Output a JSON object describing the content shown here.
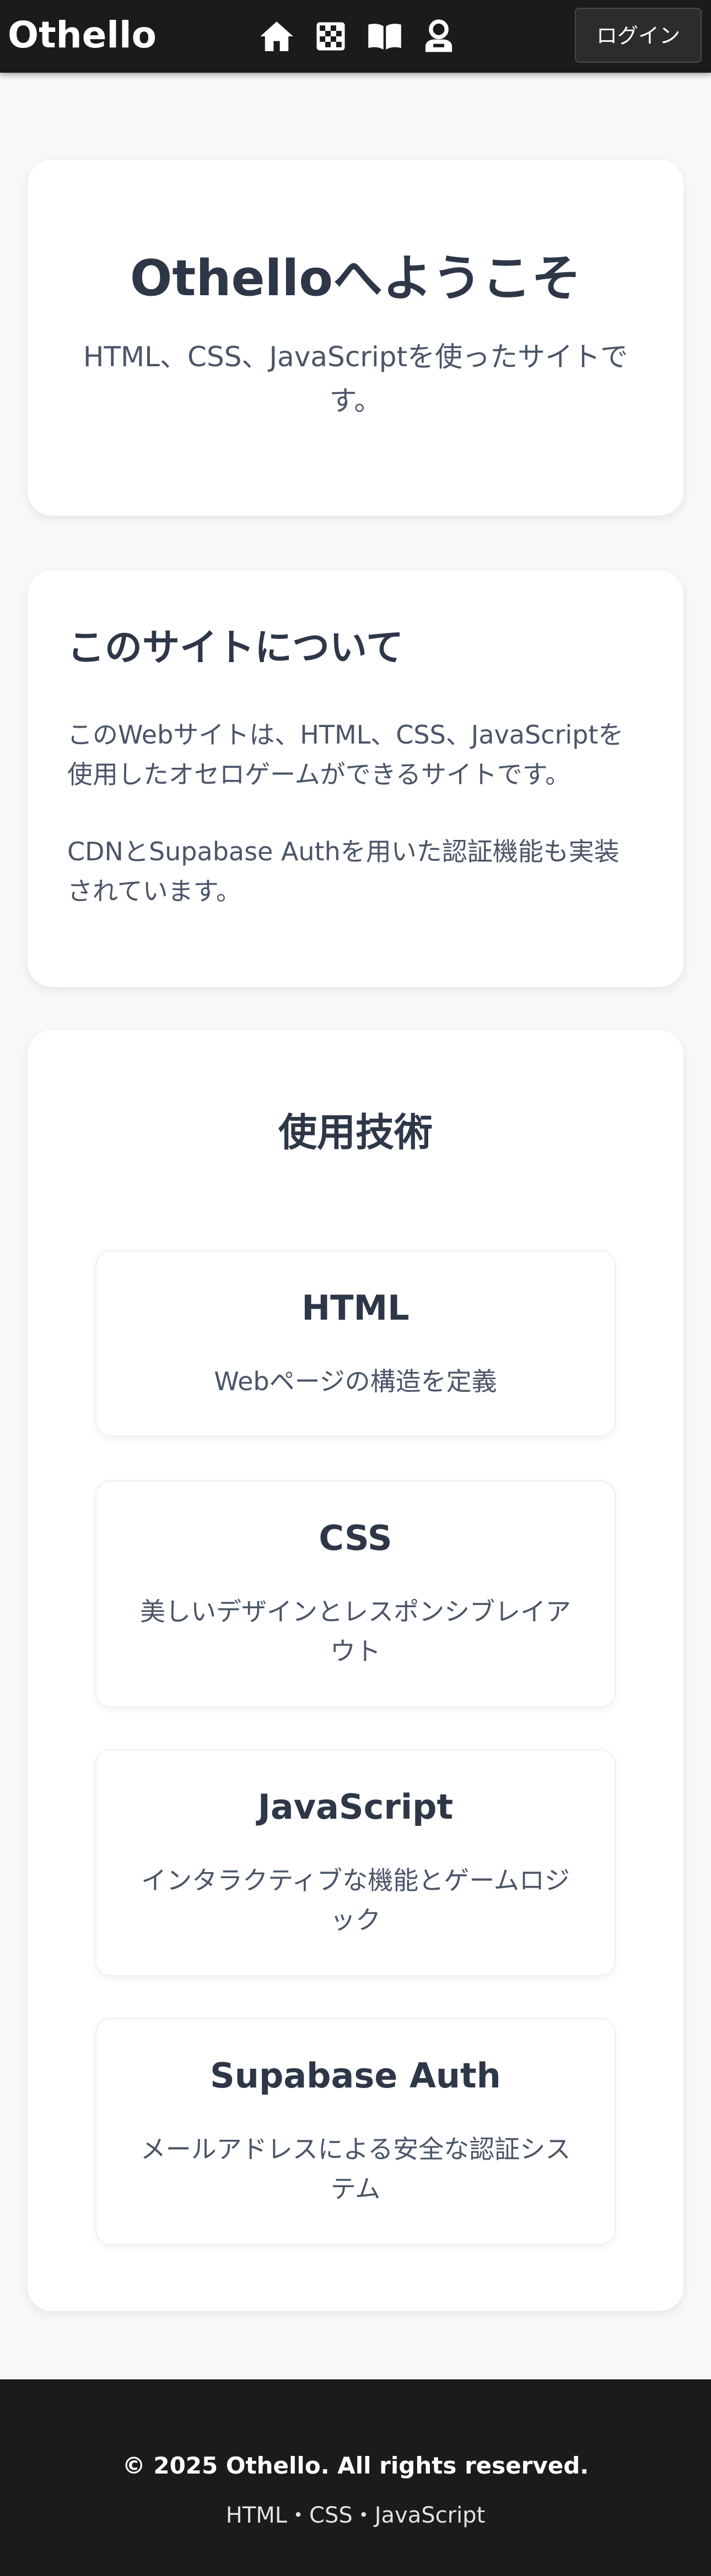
{
  "header": {
    "brand": "Othello",
    "nav": [
      {
        "icon": "home-icon"
      },
      {
        "icon": "checkerboard-icon"
      },
      {
        "icon": "book-icon"
      },
      {
        "icon": "user-icon"
      }
    ],
    "login_label": "ログイン"
  },
  "welcome": {
    "title": "Othelloへようこそ",
    "subtitle": "HTML、CSS、JavaScriptを使ったサイトです。"
  },
  "about": {
    "title": "このサイトについて",
    "paragraphs": [
      "このWebサイトは、HTML、CSS、JavaScriptを使用したオセロゲームができるサイトです。",
      "CDNとSupabase Authを用いた認証機能も実装されています。"
    ]
  },
  "tech": {
    "title": "使用技術",
    "items": [
      {
        "name": "HTML",
        "desc": "Webページの構造を定義"
      },
      {
        "name": "CSS",
        "desc": "美しいデザインとレスポンシブレイアウト"
      },
      {
        "name": "JavaScript",
        "desc": "インタラクティブな機能とゲームロジック"
      },
      {
        "name": "Supabase Auth",
        "desc": "メールアドレスによる安全な認証システム"
      }
    ]
  },
  "footer": {
    "copyright": "© 2025 Othello. All rights reserved.",
    "tech_line": "HTML・CSS・JavaScript"
  },
  "colors": {
    "header_bg": "#1b1b1b",
    "page_bg": "#f7f8fa",
    "heading": "#2d3748",
    "body_text": "#4a5568"
  }
}
